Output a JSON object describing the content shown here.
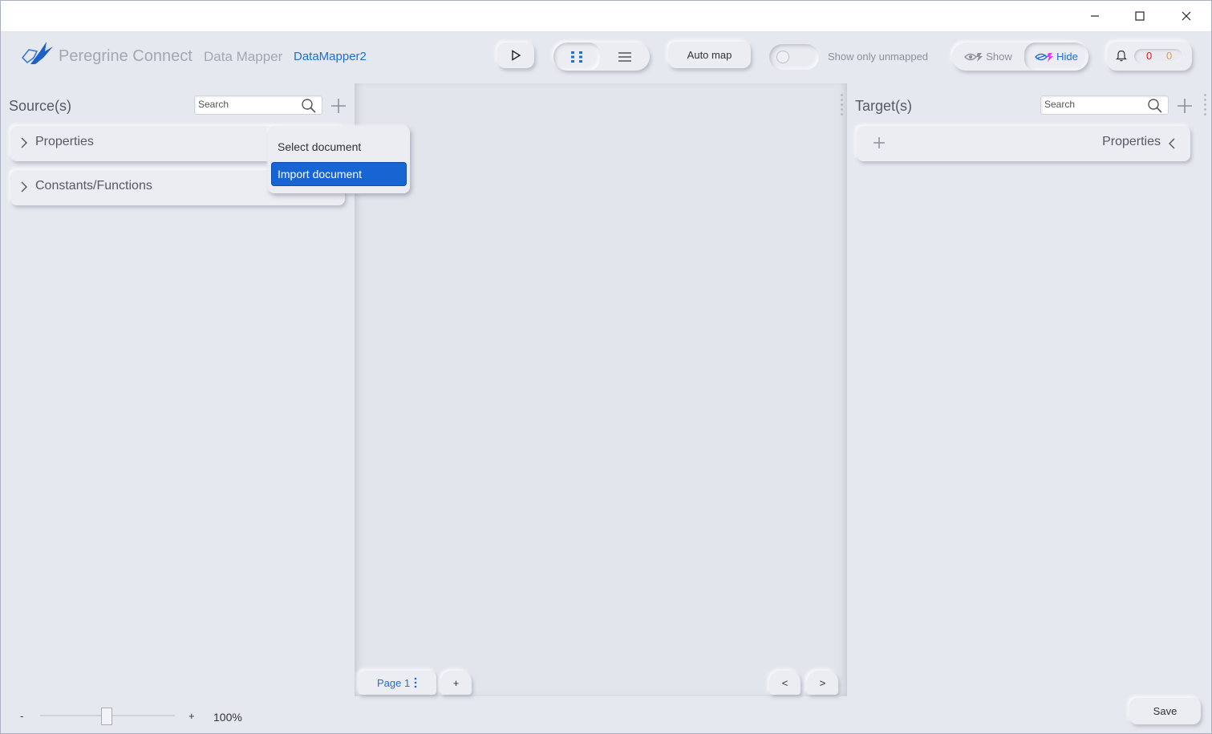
{
  "header": {
    "brand": "Peregrine Connect",
    "brand_sub": "Data Mapper",
    "mapper_name": "DataMapper2",
    "auto_map_label": "Auto map",
    "show_only_unmapped_label": "Show only unmapped",
    "show_label": "Show",
    "hide_label": "Hide",
    "notifications": {
      "error_count": "0",
      "warning_count": "0"
    }
  },
  "source_panel": {
    "title": "Source(s)",
    "search_placeholder": "Search",
    "items": [
      {
        "label": "Properties"
      },
      {
        "label": "Constants/Functions"
      }
    ]
  },
  "dropdown": {
    "items": [
      {
        "label": "Select document",
        "selected": false
      },
      {
        "label": "Import document",
        "selected": true
      }
    ]
  },
  "target_panel": {
    "title": "Target(s)",
    "search_placeholder": "Search",
    "items": [
      {
        "label": "Properties"
      }
    ]
  },
  "canvas": {
    "page_tab_label": "Page 1",
    "add_page_label": "+",
    "prev_label": "<",
    "next_label": ">"
  },
  "footer": {
    "zoom_minus": "-",
    "zoom_plus": "+",
    "zoom_value": "100%",
    "save_label": "Save"
  },
  "colors": {
    "accent": "#1f6fd1",
    "selected_item": "#1764d3",
    "background": "#e6e8ef",
    "error_count": "#e02020",
    "warning_count": "#f0a020",
    "hide_icon": "#e03cf0"
  },
  "icons": {
    "logo": "bird-logo",
    "run": "play-icon",
    "grid_view": "grid-view-icon",
    "list_view": "list-view-icon",
    "show": "eye-icon",
    "hide": "eye-off-icon",
    "notifications": "bell-icon"
  }
}
